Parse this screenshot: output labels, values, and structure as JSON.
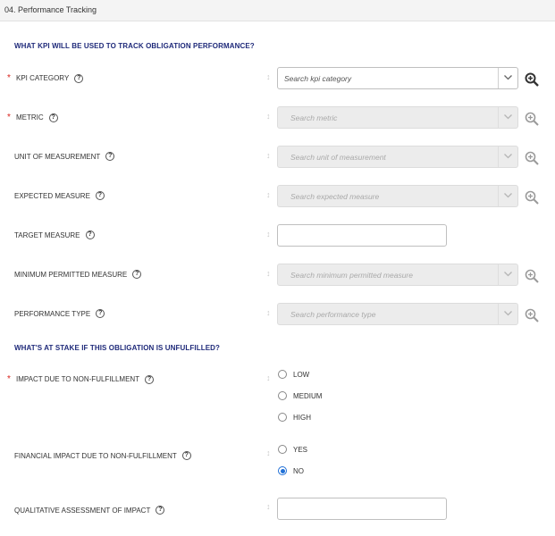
{
  "header": {
    "title": "04. Performance Tracking"
  },
  "sections": {
    "kpi_title": "WHAT KPI WILL BE USED TO TRACK OBLIGATION PERFORMANCE?",
    "stake_title": "WHAT'S AT STAKE IF THIS OBLIGATION IS UNFULFILLED?"
  },
  "required_mark": "*",
  "help_glyph": "?",
  "sort_glyph": "↕",
  "fields": {
    "kpi_category": {
      "label": "KPI CATEGORY",
      "placeholder": "Search kpi category"
    },
    "metric": {
      "label": "METRIC",
      "placeholder": "Search metric"
    },
    "unit": {
      "label": "UNIT OF MEASUREMENT",
      "placeholder": "Search unit of measurement"
    },
    "expected": {
      "label": "EXPECTED MEASURE",
      "placeholder": "Search expected measure"
    },
    "target": {
      "label": "TARGET MEASURE",
      "value": ""
    },
    "minimum": {
      "label": "MINIMUM PERMITTED MEASURE",
      "placeholder": "Search minimum permitted measure"
    },
    "perf_type": {
      "label": "PERFORMANCE TYPE",
      "placeholder": "Search performance type"
    },
    "impact": {
      "label": "IMPACT DUE TO NON-FULFILLMENT",
      "options": [
        "LOW",
        "MEDIUM",
        "HIGH"
      ],
      "selected": null
    },
    "financial": {
      "label": "FINANCIAL IMPACT DUE TO NON-FULFILLMENT",
      "options": [
        "YES",
        "NO"
      ],
      "selected": "NO"
    },
    "qualitative": {
      "label": "QUALITATIVE ASSESSMENT OF IMPACT",
      "value": ""
    }
  },
  "colors": {
    "section_title": "#1f2a7a",
    "required": "#d9231d",
    "radio_selected": "#1f6fd6"
  },
  "icons": {
    "dropdown": "chevron-down-icon",
    "lookup": "zoom-in-icon",
    "help": "help-circle-icon",
    "sort": "sort-icon"
  }
}
